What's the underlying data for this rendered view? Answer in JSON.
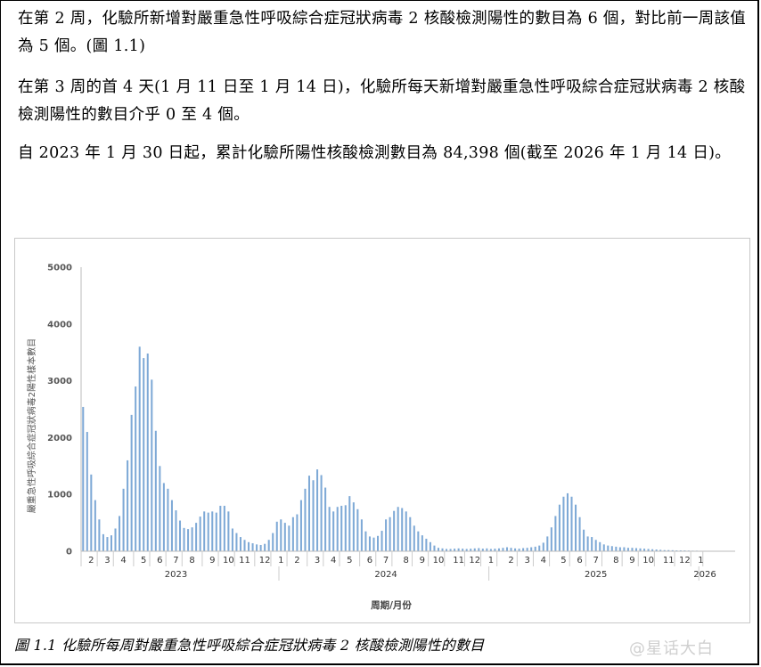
{
  "text": {
    "para1": "在第 2 周，化驗所新增對嚴重急性呼吸綜合症冠狀病毒 2 核酸檢測陽性的數目為 6 個，對比前一周該值為 5 個。(圖 1.1)",
    "para2": "在第 3 周的首 4 天(1 月 11 日至 1 月 14 日)，化驗所每天新增對嚴重急性呼吸綜合症冠狀病毒 2 核酸檢測陽性的數目介乎 0 至 4 個。",
    "para3": "自 2023 年 1 月 30 日起，累計化驗所陽性核酸檢測數目為 84,398 個(截至 2026 年 1 月 14 日)。",
    "caption": "圖 1.1  化驗所每周對嚴重急性呼吸綜合症冠狀病毒 2 核酸檢測陽性的數目",
    "watermark": "@星话大白"
  },
  "chart_data": {
    "type": "bar",
    "ylabel": "嚴重急性呼吸綜合症冠狀病毒2陽性樣本數目",
    "xlabel": "周期/月份",
    "ylim": [
      0,
      5000
    ],
    "yticks": [
      0,
      1000,
      2000,
      3000,
      4000,
      5000
    ],
    "color": "#7ea9d6",
    "month_labels": [
      {
        "label": "2",
        "week": 2
      },
      {
        "label": "3",
        "week": 6
      },
      {
        "label": "4",
        "week": 10
      },
      {
        "label": "5",
        "week": 15
      },
      {
        "label": "6",
        "week": 19
      },
      {
        "label": "7",
        "week": 23
      },
      {
        "label": "8",
        "week": 27
      },
      {
        "label": "9",
        "week": 32
      },
      {
        "label": "10",
        "week": 36
      },
      {
        "label": "11",
        "week": 40
      },
      {
        "label": "12",
        "week": 45
      },
      {
        "label": "1",
        "week": 49
      },
      {
        "label": "2",
        "week": 53
      },
      {
        "label": "3",
        "week": 58
      },
      {
        "label": "4",
        "week": 62
      },
      {
        "label": "5",
        "week": 66
      },
      {
        "label": "6",
        "week": 71
      },
      {
        "label": "7",
        "week": 75
      },
      {
        "label": "8",
        "week": 80
      },
      {
        "label": "9",
        "week": 84
      },
      {
        "label": "10",
        "week": 88
      },
      {
        "label": "11",
        "week": 93
      },
      {
        "label": "12",
        "week": 97
      },
      {
        "label": "1",
        "week": 101
      },
      {
        "label": "2",
        "week": 106
      },
      {
        "label": "3",
        "week": 110
      },
      {
        "label": "4",
        "week": 114
      },
      {
        "label": "5",
        "week": 119
      },
      {
        "label": "6",
        "week": 123
      },
      {
        "label": "7",
        "week": 127
      },
      {
        "label": "8",
        "week": 132
      },
      {
        "label": "9",
        "week": 136
      },
      {
        "label": "10",
        "week": 140
      },
      {
        "label": "11",
        "week": 145
      },
      {
        "label": "12",
        "week": 149
      },
      {
        "label": "1",
        "week": 153
      }
    ],
    "years": [
      {
        "label": "2023",
        "week": 23
      },
      {
        "label": "2024",
        "week": 75
      },
      {
        "label": "2025",
        "week": 127
      },
      {
        "label": "2026",
        "week": 154
      }
    ],
    "year_boundaries": [
      48,
      100,
      152
    ],
    "values": [
      2540,
      2100,
      1350,
      900,
      560,
      300,
      250,
      280,
      400,
      620,
      1100,
      1600,
      2400,
      2900,
      3600,
      3400,
      3480,
      3020,
      2120,
      1500,
      1200,
      1100,
      900,
      720,
      540,
      410,
      390,
      420,
      500,
      610,
      700,
      680,
      700,
      680,
      800,
      800,
      700,
      400,
      320,
      250,
      200,
      160,
      140,
      120,
      110,
      130,
      200,
      320,
      520,
      560,
      500,
      450,
      600,
      650,
      900,
      1100,
      1330,
      1250,
      1440,
      1340,
      1120,
      780,
      700,
      780,
      800,
      810,
      970,
      860,
      740,
      560,
      350,
      260,
      240,
      270,
      360,
      560,
      600,
      710,
      780,
      760,
      700,
      600,
      450,
      350,
      280,
      220,
      160,
      100,
      60,
      50,
      40,
      40,
      45,
      50,
      45,
      40,
      45,
      50,
      55,
      45,
      50,
      40,
      45,
      50,
      60,
      70,
      60,
      50,
      45,
      55,
      60,
      70,
      80,
      100,
      150,
      260,
      420,
      620,
      820,
      960,
      1020,
      960,
      820,
      600,
      380,
      260,
      250,
      200,
      160,
      120,
      100,
      90,
      80,
      70,
      70,
      60,
      60,
      55,
      50,
      45,
      40,
      35,
      30,
      25,
      20,
      20,
      18,
      15,
      15,
      14,
      12,
      10,
      10,
      8,
      8,
      8,
      7,
      6,
      6,
      5,
      6,
      4
    ]
  }
}
